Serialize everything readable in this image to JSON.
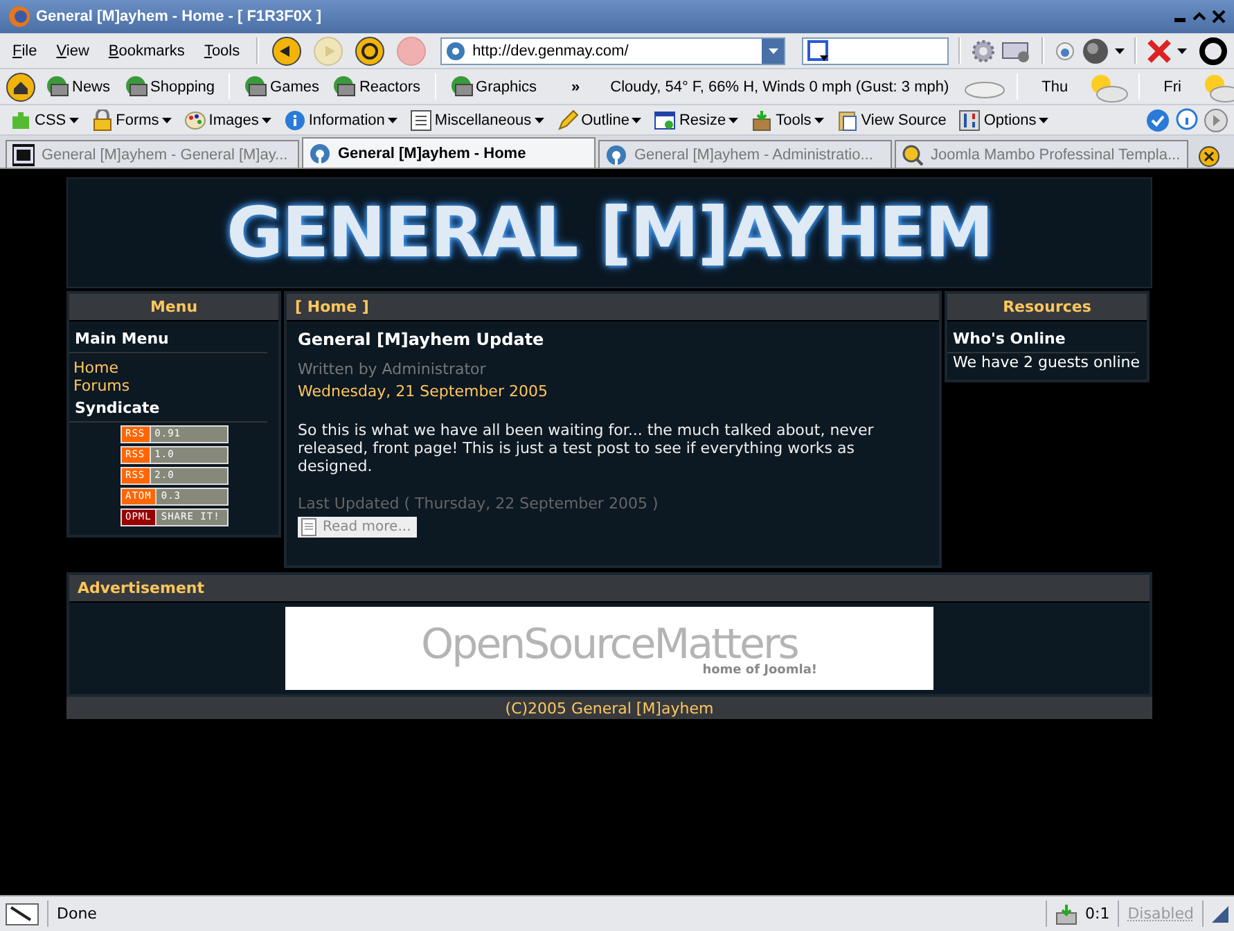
{
  "window": {
    "title": "General [M]ayhem - Home - [ F1R3F0X ]"
  },
  "menu": [
    "File",
    "View",
    "Bookmarks",
    "Tools"
  ],
  "nav_buttons": [
    {
      "kind": "back",
      "disabled": false
    },
    {
      "kind": "forward",
      "disabled": true
    },
    {
      "kind": "reload",
      "disabled": false
    },
    {
      "kind": "stop",
      "disabled": true
    }
  ],
  "address": {
    "value": "http://dev.genmay.com/"
  },
  "bookmarks": [
    "News",
    "Shopping",
    "Games",
    "Reactors",
    "Graphics"
  ],
  "bookmarks_overflow": "»",
  "weather": {
    "current": "Cloudy, 54° F, 66% H, Winds 0 mph (Gust: 3 mph)",
    "forecast": [
      {
        "day": "Thu"
      },
      {
        "day": "Fri"
      }
    ]
  },
  "dev_toolbar": [
    {
      "label": "CSS",
      "kind": "puzzle",
      "dropdown": true
    },
    {
      "label": "Forms",
      "kind": "lock",
      "dropdown": true
    },
    {
      "label": "Images",
      "kind": "palette",
      "dropdown": true
    },
    {
      "label": "Information",
      "kind": "info",
      "dropdown": true
    },
    {
      "label": "Miscellaneous",
      "kind": "list",
      "dropdown": true
    },
    {
      "label": "Outline",
      "kind": "pencil",
      "dropdown": true
    },
    {
      "label": "Resize",
      "kind": "window",
      "dropdown": true
    },
    {
      "label": "Tools",
      "kind": "box",
      "dropdown": true
    },
    {
      "label": "View Source",
      "kind": "clipboard",
      "dropdown": false
    },
    {
      "label": "Options",
      "kind": "sliders",
      "dropdown": true
    }
  ],
  "tabs": [
    {
      "label": "General [M]ayhem - General [M]ay...",
      "kind": "site",
      "selected": false
    },
    {
      "label": "General [M]ayhem - Home",
      "kind": "globe",
      "selected": true
    },
    {
      "label": "General [M]ayhem - Administratio...",
      "kind": "globe",
      "selected": false
    },
    {
      "label": "Joomla Mambo Professinal Templa...",
      "kind": "search",
      "selected": false
    }
  ],
  "page": {
    "banner": "GENERAL [M]AYHEM",
    "menu": {
      "title": "Menu",
      "heading": "Main Menu",
      "links": [
        "Home",
        "Forums"
      ],
      "syndicate": "Syndicate",
      "feeds": [
        {
          "type": "RSS",
          "version": "0.91",
          "color": "#ff6600"
        },
        {
          "type": "RSS",
          "version": "1.0",
          "color": "#ff6600"
        },
        {
          "type": "RSS",
          "version": "2.0",
          "color": "#ff6600"
        },
        {
          "type": "ATOM",
          "version": "0.3",
          "color": "#ff6600"
        },
        {
          "type": "OPML",
          "version": "SHARE IT!",
          "color": "#990000"
        }
      ]
    },
    "content": {
      "breadcrumb": "[ Home ]",
      "title": "General [M]ayhem Update",
      "author": "Written by Administrator",
      "date": "Wednesday, 21 September 2005",
      "body": "So this is what we have all been waiting for... the much talked about, never released, front page! This is just a test post to see if everything works as designed.",
      "updated": "Last Updated ( Thursday, 22 September 2005 )",
      "read_more": "Read more..."
    },
    "resources": {
      "title": "Resources",
      "heading": "Who's Online",
      "text": "We have 2 guests online"
    },
    "advertisement": {
      "title": "Advertisement",
      "ad_name": "OpenSourceMatters",
      "ad_tagline": "home of Joomla!"
    },
    "footer": "(C)2005 General [M]ayhem"
  },
  "status_bar": {
    "text": "Done",
    "counter": "0:1",
    "script_state": "Disabled"
  }
}
